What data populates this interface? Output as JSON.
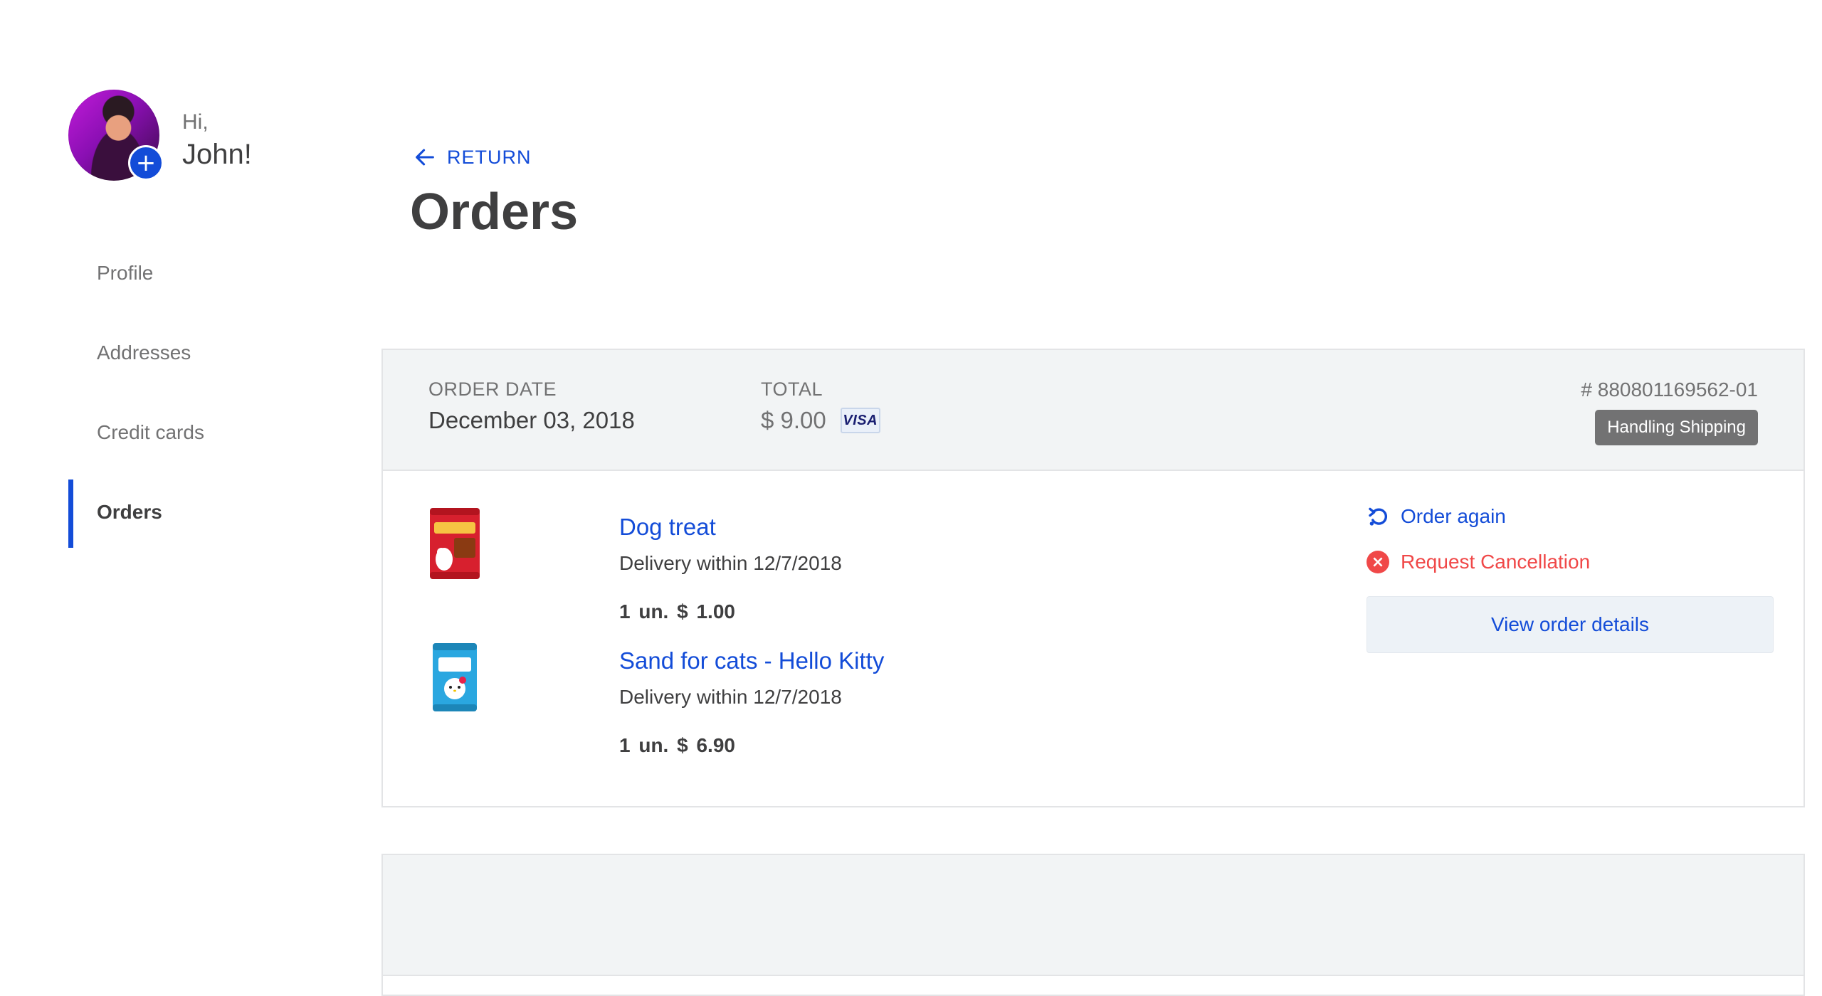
{
  "sidebar": {
    "greeting_hi": "Hi,",
    "greeting_name": "John!",
    "avatar_add_icon": "+",
    "items": [
      {
        "label": "Profile",
        "active": false
      },
      {
        "label": "Addresses",
        "active": false
      },
      {
        "label": "Credit cards",
        "active": false
      },
      {
        "label": "Orders",
        "active": true
      }
    ]
  },
  "main": {
    "return_label": "RETURN",
    "title": "Orders"
  },
  "orders": [
    {
      "date_label": "ORDER DATE",
      "date": "December 03, 2018",
      "total_label": "TOTAL",
      "total": "$ 9.00",
      "payment_brand": "VISA",
      "order_number": "# 880801169562-01",
      "status": "Handling Shipping",
      "products": [
        {
          "name": "Dog treat",
          "delivery": "Delivery within 12/7/2018",
          "quantity_price": "1 un.  $ 1.00"
        },
        {
          "name": "Sand for cats - Hello Kitty",
          "delivery": "Delivery within 12/7/2018",
          "quantity_price": "1 un.  $ 6.90"
        }
      ],
      "actions": {
        "order_again": "Order again",
        "request_cancellation": "Request Cancellation",
        "view_details": "View order details"
      }
    }
  ],
  "colors": {
    "accent": "#134cd8",
    "danger": "#f04848",
    "muted_text": "#727273",
    "header_bg": "#f2f4f5"
  }
}
